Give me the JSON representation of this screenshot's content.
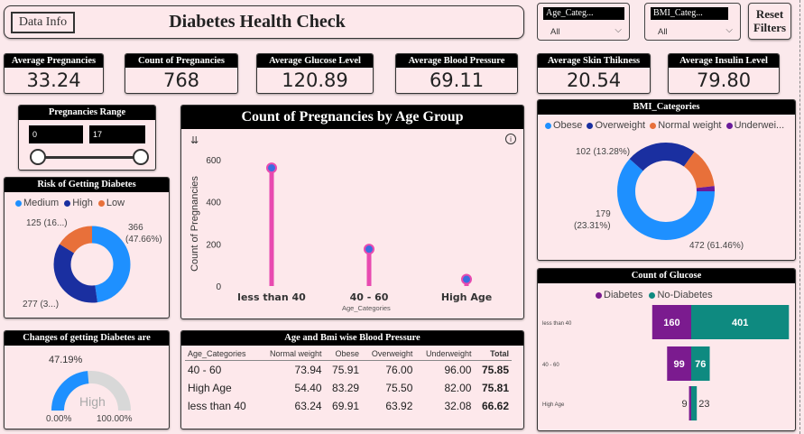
{
  "header": {
    "data_info_button": "Data Info",
    "title": "Diabetes Health Check",
    "reset_button": "Reset\nFilters"
  },
  "slicers": [
    {
      "label": "Age_Categ...",
      "value": "All"
    },
    {
      "label": "BMI_Categ...",
      "value": "All"
    }
  ],
  "kpis": [
    {
      "title": "Average Pregnancies",
      "value": "33.24"
    },
    {
      "title": "Count of Pregnancies",
      "value": "768"
    },
    {
      "title": "Average Glucose Level",
      "value": "120.89"
    },
    {
      "title": "Average Blood Pressure",
      "value": "69.11"
    },
    {
      "title": "Average Skin Thikness",
      "value": "20.54"
    },
    {
      "title": "Average Insulin Level",
      "value": "79.80"
    }
  ],
  "pregnancies_range": {
    "title": "Pregnancies Range",
    "min": "0",
    "max": "17"
  },
  "risk": {
    "title": "Risk of Getting Diabetes",
    "legend": [
      {
        "name": "Medium",
        "color": "#1e90ff"
      },
      {
        "name": "High",
        "color": "#1a2fa0"
      },
      {
        "name": "Low",
        "color": "#e8703a"
      }
    ],
    "labels": {
      "low": "125 (16...)",
      "medium_a": "366",
      "medium_b": "(47.66%)",
      "high": "277 (3...)"
    },
    "values": [
      366,
      277,
      125
    ]
  },
  "changes": {
    "title": "Changes of getting Diabetes are",
    "pct": "47.19%",
    "center": "High",
    "min": "0.00%",
    "max": "100.00%",
    "fraction": 0.4719
  },
  "preg_chart": {
    "title": "Count of Pregnancies by Age Group",
    "ylabel": "Count of Pregnancies",
    "xlabel": "Age_Categories",
    "yticks": [
      "0",
      "200",
      "400",
      "600"
    ],
    "sort_icon": "sort-icon",
    "info_icon": "info-icon"
  },
  "chart_data": [
    {
      "type": "lollipop",
      "title": "Count of Pregnancies by Age Group",
      "categories": [
        "less than 40",
        "40 - 60",
        "High Age"
      ],
      "values": [
        561,
        175,
        32
      ],
      "ylim": [
        0,
        650
      ],
      "ylabel": "Count of Pregnancies",
      "xlabel": "Age_Categories",
      "color": "#e84ab0"
    },
    {
      "type": "pie",
      "title": "BMI_Categories",
      "categories": [
        "Obese",
        "Overweight",
        "Normal weight",
        "Underweight"
      ],
      "values": [
        472,
        179,
        102,
        15
      ],
      "colors": [
        "#1e90ff",
        "#1a2fa0",
        "#e8703a",
        "#6a1b9a"
      ]
    },
    {
      "type": "bar",
      "title": "Count of Glucose",
      "categories": [
        "less than 40",
        "40 - 60",
        "High Age"
      ],
      "series": [
        {
          "name": "Diabetes",
          "values": [
            160,
            99,
            9
          ],
          "color": "#7b1b8f"
        },
        {
          "name": "No-Diabetes",
          "values": [
            401,
            76,
            23
          ],
          "color": "#0e8a80"
        }
      ]
    }
  ],
  "bmi": {
    "title": "BMI_Categories",
    "legend": [
      {
        "name": "Obese",
        "color": "#1e90ff"
      },
      {
        "name": "Overweight",
        "color": "#1a2fa0"
      },
      {
        "name": "Normal weight",
        "color": "#e8703a"
      },
      {
        "name": "Underwei...",
        "color": "#6a1b9a"
      }
    ],
    "labels": {
      "normal": "102 (13.28%)",
      "over_a": "179",
      "over_b": "(23.31%)",
      "obese": "472 (61.46%)"
    }
  },
  "glucose": {
    "title": "Count of Glucose",
    "legend": [
      {
        "name": "Diabetes",
        "color": "#7b1b8f"
      },
      {
        "name": "No-Diabetes",
        "color": "#0e8a80"
      }
    ]
  },
  "matrix": {
    "title": "Age and Bmi wise Blood Pressure",
    "columns": [
      "Age_Categories",
      "Normal weight",
      "Obese",
      "Overweight",
      "Underweight",
      "Total"
    ],
    "rows": [
      [
        "40 - 60",
        "73.94",
        "75.91",
        "76.00",
        "96.00",
        "75.85"
      ],
      [
        "High Age",
        "54.40",
        "83.29",
        "75.50",
        "82.00",
        "75.81"
      ],
      [
        "less than 40",
        "63.24",
        "69.91",
        "63.92",
        "32.08",
        "66.62"
      ]
    ]
  }
}
